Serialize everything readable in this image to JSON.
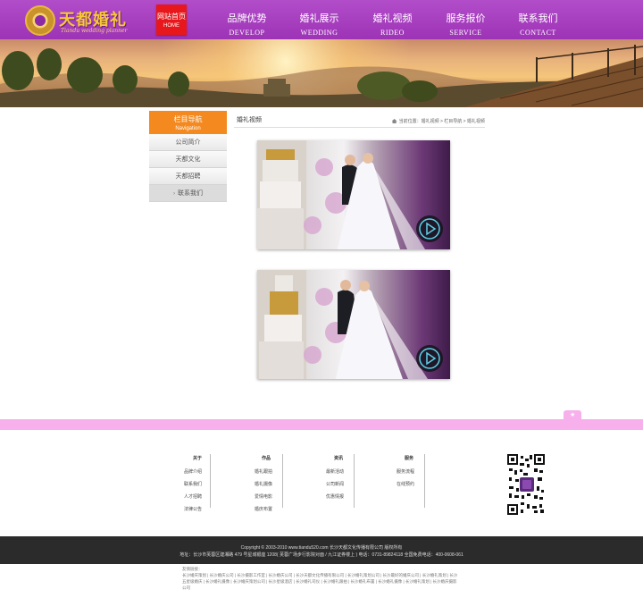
{
  "header": {
    "logo_text": "天都婚礼",
    "logo_sub": "Tiandu wedding planner",
    "home": {
      "cn": "网站首页",
      "en": "HOME"
    },
    "nav": [
      {
        "cn": "品牌优势",
        "en": "DEVELOP"
      },
      {
        "cn": "婚礼展示",
        "en": "WEDDING"
      },
      {
        "cn": "婚礼视频",
        "en": "RIDEO"
      },
      {
        "cn": "服务报价",
        "en": "SERVICE"
      },
      {
        "cn": "联系我们",
        "en": "CONTACT"
      }
    ]
  },
  "sidebar": {
    "title": "栏目导航",
    "title_en": "Navigation",
    "items": [
      "公司简介",
      "天都文化",
      "天都招聘",
      "联系我们"
    ]
  },
  "content": {
    "title": "婚礼视频",
    "breadcrumb": "当前位置：婚礼视频 > 栏目导航 > 婚礼视频"
  },
  "footer": {
    "columns": [
      {
        "head": "关于",
        "links": [
          "品牌介绍",
          "联系我们",
          "人才招聘",
          "法律公告"
        ]
      },
      {
        "head": "作品",
        "links": [
          "婚礼跟拍",
          "婚礼摄像",
          "爱情电影",
          "婚庆布置"
        ]
      },
      {
        "head": "资讯",
        "links": [
          "最新活动",
          "公司新闻",
          "优惠情报"
        ]
      },
      {
        "head": "服务",
        "links": [
          "服务流程",
          "在线预约"
        ]
      }
    ],
    "copyright": "Copyright © 2003-2010 www.tiandu520.com 长沙天都文化传播有限公司 版权所有",
    "address": "地址：长沙市芙蓉区建湘路 479 号星城银座 1208( 芙蓉广场步行影院对面 / 九江证券楼上 )  电话：0731-89824118  全国免费电话：400-0608-061",
    "friends_label": "友情链接：",
    "friends": [
      "长沙婚庆策划",
      "长沙婚庆公司",
      "长沙摄影工作室",
      "长沙婚庆公司",
      "长沙天都文化传播有限公司",
      "长沙婚礼策划公司",
      "长沙最好的婚庆公司",
      "长沙婚礼策划",
      "长沙五星级婚庆",
      "长沙婚礼摄像",
      "长沙婚庆策划公司",
      "长沙星级酒店",
      "长沙婚礼司仪",
      "长沙婚礼跟拍",
      "长沙婚礼布置",
      "长沙婚礼摄像",
      "长沙婚礼策划",
      "长沙婚庆摄影公司"
    ],
    "accent": "#f7b0ec"
  },
  "colors": {
    "brand_purple": "#a63bbf",
    "sidebar_orange": "#f4891f",
    "home_red": "#e7171b"
  }
}
